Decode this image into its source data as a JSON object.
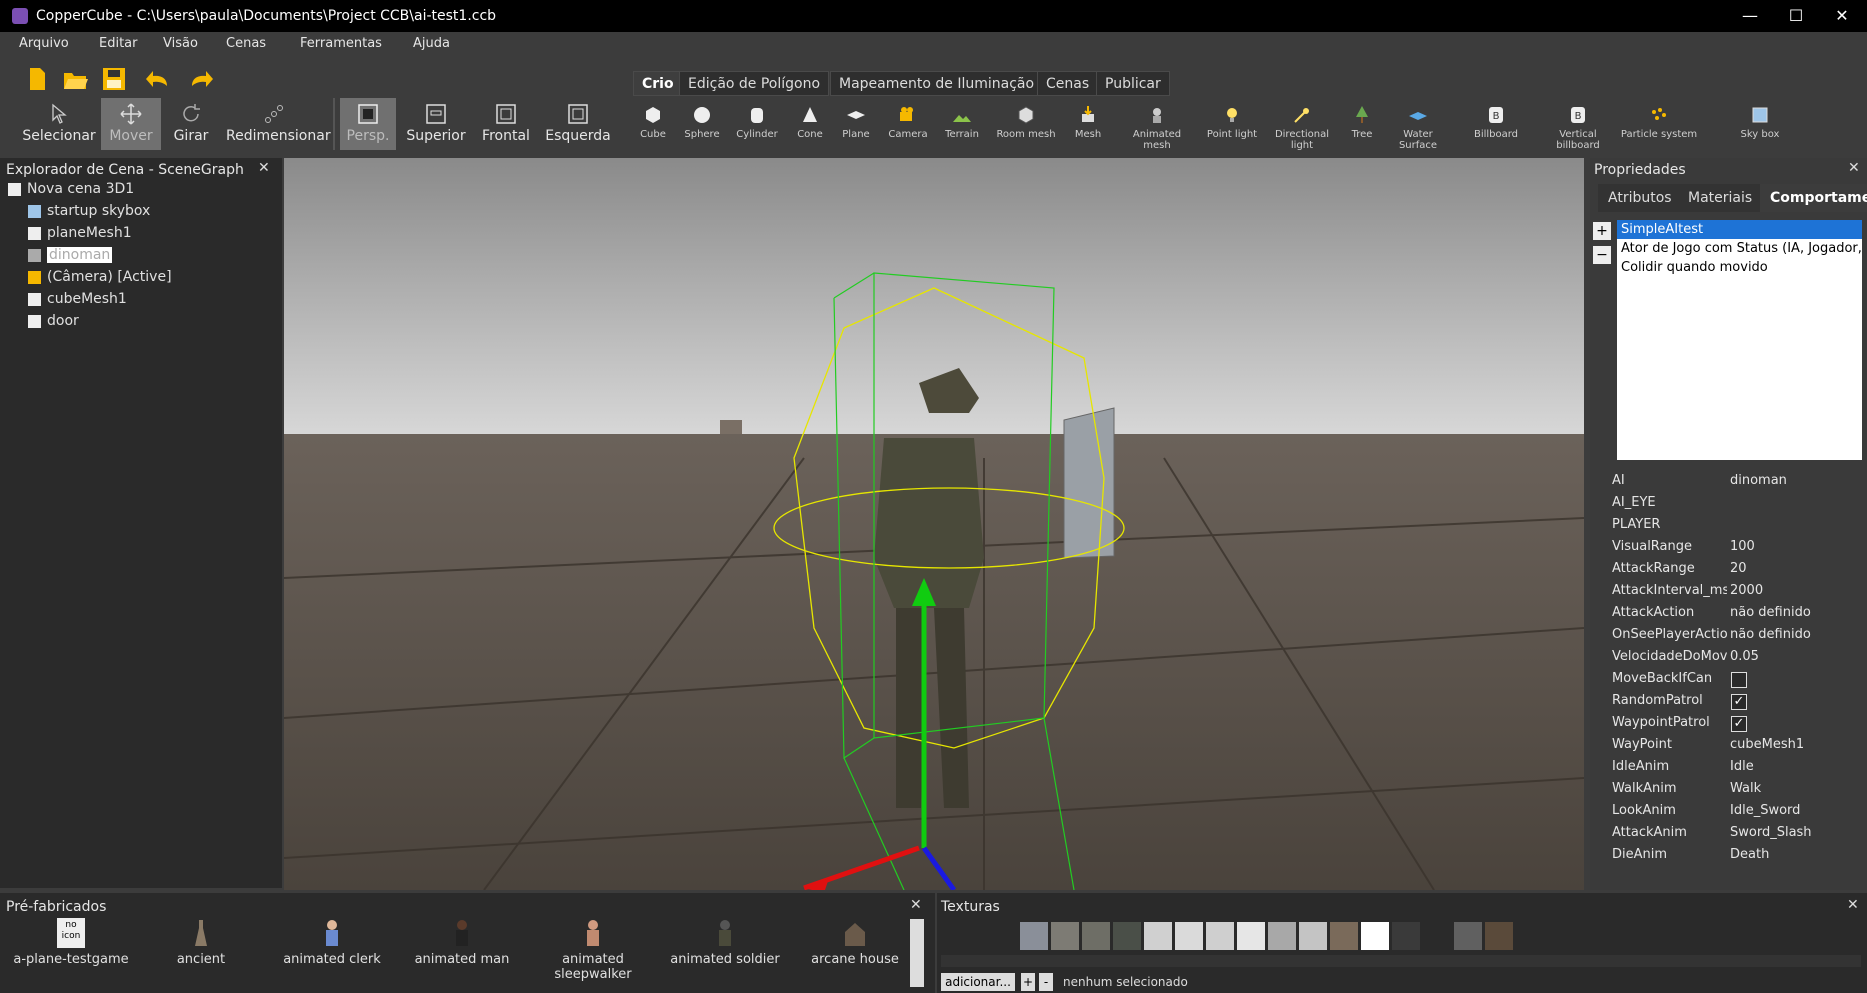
{
  "window": {
    "title": "CopperCube - C:\\Users\\paula\\Documents\\Project CCB\\ai-test1.ccb",
    "min": "—",
    "max": "☐",
    "close": "✕"
  },
  "menu": [
    "Arquivo",
    "Editar",
    "Visão",
    "Cenas",
    "Ferramentas",
    "Ajuda"
  ],
  "tools": {
    "select": "Selecionar",
    "move": "Mover",
    "rotate": "Girar",
    "resize": "Redimensionar",
    "persp": "Persp.",
    "top": "Superior",
    "front": "Frontal",
    "left": "Esquerda"
  },
  "tabs": [
    "Crio",
    "Edição de Polígono",
    "Mapeamento de Iluminação",
    "Cenas",
    "Publicar"
  ],
  "create_tools": [
    "Cube",
    "Sphere",
    "Cylinder",
    "Cone",
    "Plane",
    "Camera",
    "Terrain",
    "Room mesh",
    "Mesh",
    "Animated mesh",
    "Point light",
    "Directional light",
    "Tree",
    "Water Surface",
    "Billboard",
    "Vertical billboard",
    "Particle system",
    "Sky box"
  ],
  "scenegraph": {
    "title": "Explorador de Cena - SceneGraph",
    "items": [
      "Nova cena 3D1",
      "startup skybox",
      "planeMesh1",
      "dinoman",
      "(Câmera) [Active]",
      "cubeMesh1",
      "door"
    ]
  },
  "properties": {
    "title": "Propriedades",
    "tabs": [
      "Atributos",
      "Materiais",
      "Comportamentos"
    ],
    "behaviors": [
      "SimpleAItest",
      "Ator de Jogo com Status (IA, Jogador, etc)",
      "Colidir quando movido"
    ],
    "add": "+",
    "remove": "−",
    "rows": [
      {
        "k": "AI",
        "v": "dinoman"
      },
      {
        "k": "AI_EYE",
        "v": ""
      },
      {
        "k": "PLAYER",
        "v": ""
      },
      {
        "k": "VisualRange",
        "v": "100"
      },
      {
        "k": "AttackRange",
        "v": "20"
      },
      {
        "k": "AttackInterval_ms",
        "v": "2000"
      },
      {
        "k": "AttackAction",
        "v": "não definido"
      },
      {
        "k": "OnSeePlayerAction",
        "v": "não definido"
      },
      {
        "k": "VelocidadeDoMovimento",
        "v": "0.05"
      },
      {
        "k": "MoveBackIfCan",
        "v": "",
        "check": false
      },
      {
        "k": "RandomPatrol",
        "v": "",
        "check": true
      },
      {
        "k": "WaypointPatrol",
        "v": "",
        "check": true
      },
      {
        "k": "WayPoint",
        "v": "cubeMesh1"
      },
      {
        "k": "IdleAnim",
        "v": "Idle"
      },
      {
        "k": "WalkAnim",
        "v": "Walk"
      },
      {
        "k": "LookAnim",
        "v": "Idle_Sword"
      },
      {
        "k": "AttackAnim",
        "v": "Sword_Slash"
      },
      {
        "k": "DieAnim",
        "v": "Death"
      }
    ]
  },
  "prefabs": {
    "title": "Pré-fabricados",
    "noicon": "no icon",
    "items": [
      "a-plane-testgame",
      "ancient",
      "animated clerk",
      "animated man",
      "animated sleepwalker",
      "animated soldier",
      "arcane house"
    ]
  },
  "textures": {
    "title": "Texturas",
    "add": "adicionar...",
    "plus": "+",
    "minus": "-",
    "status": "nenhum selecionado"
  },
  "colors": {
    "bg": "#3c3c3c",
    "panel": "#2a2a2a",
    "select": "#1e73d6",
    "bbox_yellow": "#e6e600",
    "bbox_green": "#22cc22"
  }
}
